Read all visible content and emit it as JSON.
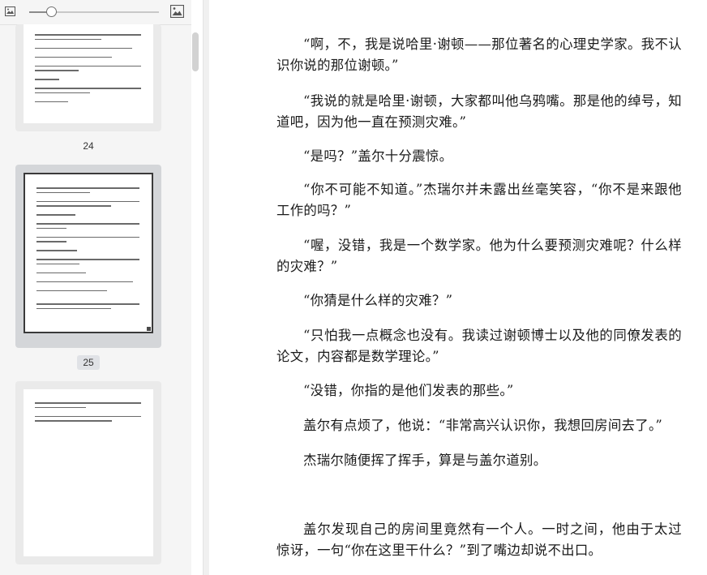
{
  "toolbar": {
    "zoom_out_icon": "image-small-icon",
    "zoom_in_icon": "image-large-icon",
    "zoom_level": 0.17
  },
  "thumbnails": [
    {
      "label": "24",
      "selected": false
    },
    {
      "label": "25",
      "selected": true
    },
    {
      "label": "",
      "selected": false
    }
  ],
  "document": {
    "paragraphs": [
      "“啊，不，我是说哈里·谢顿——那位著名的心理史学家。我不认识你说的那位谢顿。”",
      "“我说的就是哈里·谢顿，大家都叫他乌鸦嘴。那是他的绰号，知道吧，因为他一直在预测灾难。”",
      "“是吗？”盖尔十分震惊。",
      "“你不可能不知道。”杰瑞尔并未露出丝毫笑容，“你不是来跟他工作的吗？”",
      "“喔，没错，我是一个数学家。他为什么要预测灾难呢？什么样的灾难？”",
      "“你猜是什么样的灾难？”",
      "“只怕我一点概念也没有。我读过谢顿博士以及他的同僚发表的论文，内容都是数学理论。”",
      "“没错，你指的是他们发表的那些。”",
      "盖尔有点烦了，他说：“非常高兴认识你，我想回房间去了。”",
      "杰瑞尔随便挥了挥手，算是与盖尔道别。",
      "盖尔发现自己的房间里竟然有一个人。一时之间，他由于太过惊讶，一句“你在这里干什么？”到了嘴边却说不出口。"
    ]
  },
  "colors": {
    "sidebar_bg": "#f5f5f5",
    "selected_card": "#d4d6d9",
    "text": "#1a1a1a"
  }
}
